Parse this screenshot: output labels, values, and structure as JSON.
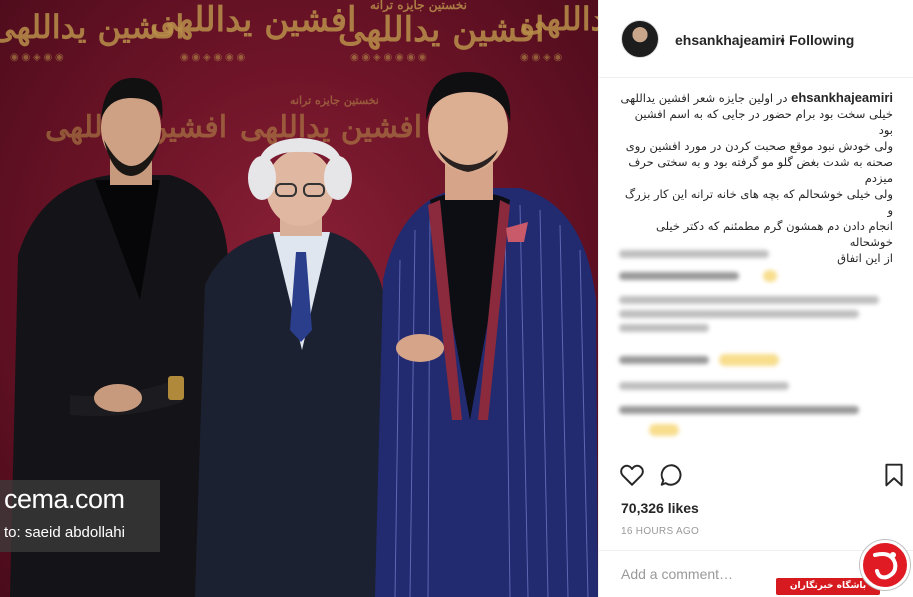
{
  "post": {
    "username": "ehsankhajeamiri",
    "separator": "•",
    "follow_status": "Following",
    "caption_user": "ehsankhajeamiri",
    "caption_lines": [
      "در اولین جایزه شعر افشین یداللهی",
      "خیلی سخت بود برام حضور در جایی که به اسم افشین بود",
      "ولی خودش نبود موقع صحبت کردن در مورد افشین روی",
      "صحنه به شدت بغض گلو مو گرفته بود و به سختی حرف",
      "میزدم",
      "ولی خیلی خوشحالم که بچه های خانه ترانه این کار بزرگ و",
      "انجام دادن دم همشون گرم مطمئنم که دکتر خیلی خوشحاله",
      "از این اتفاق"
    ],
    "likes": "70,326 likes",
    "timestamp": "16 HOURS AGO",
    "comment_placeholder": "Add a comment…"
  },
  "photo": {
    "poster_title": "افشین یداللهی",
    "poster_subtitle": "نخستین جایزه ترانه",
    "watermark_brand": "cema.com",
    "watermark_credit": "to: saeid abdollahi"
  },
  "badge": {
    "label": "باشگاه خبرنگاران"
  },
  "icons": {
    "like": "heart-icon",
    "comment": "comment-icon",
    "save": "bookmark-icon",
    "badge_logo": "news-logo-icon"
  },
  "colors": {
    "backdrop": "#6e1428",
    "poster_gold": "#b9904a",
    "badge_red": "#d71920",
    "muted_text": "#999999"
  }
}
